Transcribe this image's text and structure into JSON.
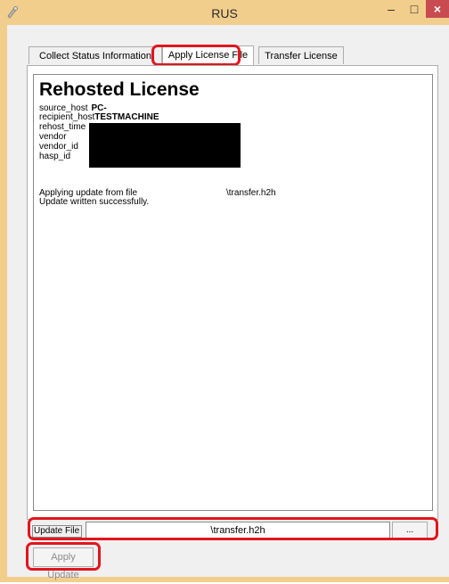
{
  "window": {
    "title": "RUS",
    "min_glyph": "–",
    "max_glyph": "□",
    "close_glyph": "×"
  },
  "tabs": [
    {
      "label": "Collect Status Information",
      "active": false
    },
    {
      "label": "Apply License File",
      "active": true
    },
    {
      "label": "Transfer License",
      "active": false
    }
  ],
  "content": {
    "heading": "Rehosted License",
    "fields": [
      {
        "key": "source_host",
        "value": "PC-"
      },
      {
        "key": "recipient_host",
        "value": "TESTMACHINE"
      },
      {
        "key": "rehost_time",
        "value": ""
      },
      {
        "key": "vendor",
        "value": ""
      },
      {
        "key": "vendor_id",
        "value": ""
      },
      {
        "key": "hasp_id",
        "value": ""
      }
    ],
    "apply_line": "Applying update from file",
    "apply_file": "\\transfer.h2h",
    "success_line": "Update written successfully."
  },
  "update_file": {
    "label": "Update File",
    "value": "\\transfer.h2h",
    "browse_label": "..."
  },
  "apply_button": {
    "label": "Apply Update",
    "enabled": false
  },
  "colors": {
    "titlebar": "#f2ce8c",
    "close": "#c74b50",
    "highlight": "#e2151e"
  }
}
